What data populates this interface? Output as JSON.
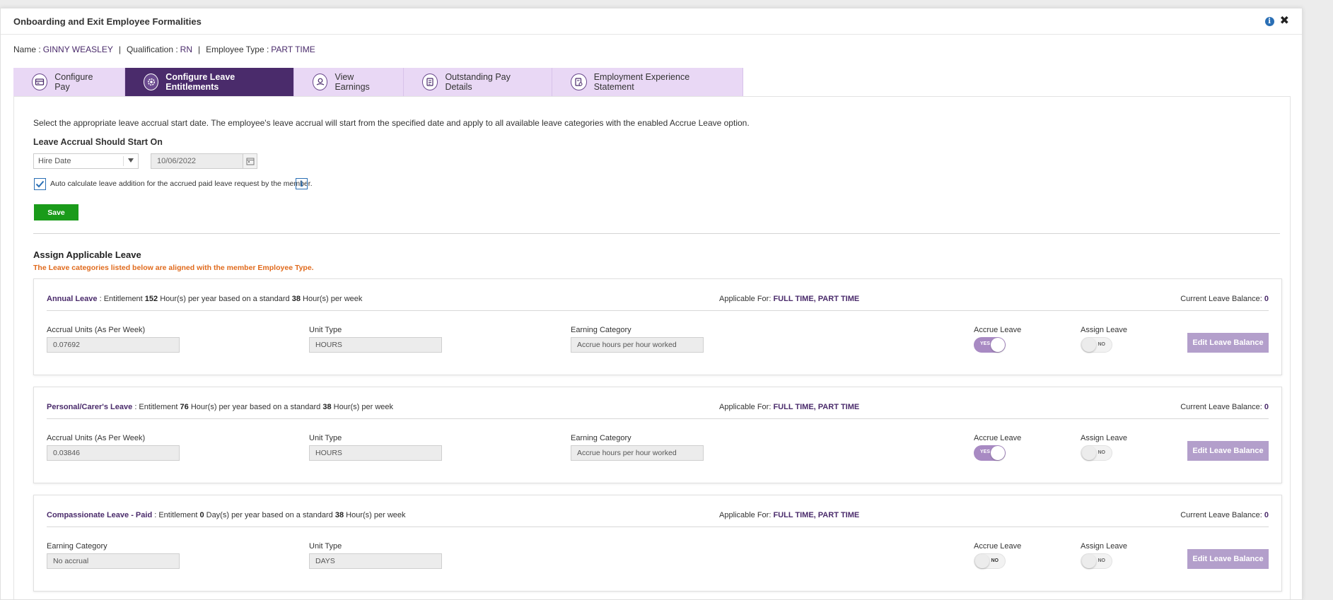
{
  "modal": {
    "title": "Onboarding and Exit Employee Formalities",
    "icons": [
      "info-icon",
      "close-icon"
    ]
  },
  "employee": {
    "name_label": "Name :",
    "name": "GINNY WEASLEY",
    "qual_label": "Qualification :",
    "qualification": "RN",
    "type_label": "Employee Type :",
    "type": "PART TIME",
    "separator": "|"
  },
  "tabs": [
    {
      "label": "Configure Pay",
      "icon": "card-icon",
      "active": false
    },
    {
      "label": "Configure Leave Entitlements",
      "icon": "gear-icon",
      "active": true
    },
    {
      "label": "View Earnings",
      "icon": "earnings-icon",
      "active": false
    },
    {
      "label": "Outstanding Pay Details",
      "icon": "document-icon",
      "active": false
    },
    {
      "label": "Employment Experience Statement",
      "icon": "statement-icon",
      "active": false
    }
  ],
  "accrual": {
    "intro": "Select the appropriate leave accrual start date. The employee's leave accrual will start from the specified date and apply to all available leave categories with the enabled Accrue Leave option.",
    "label": "Leave Accrual Should Start On",
    "select_value": "Hire Date",
    "date_value": "10/06/2022",
    "auto_calc_label": "Auto calculate leave addition for the accrued paid leave request by the member.",
    "auto_calc_checked": true,
    "save_label": "Save"
  },
  "assign": {
    "title": "Assign Applicable Leave",
    "note": "The Leave categories listed below are aligned with the member Employee Type."
  },
  "common": {
    "applicable_label": "Applicable For:",
    "balance_label": "Current Leave Balance:",
    "accrue_label": "Accrue Leave",
    "assign_label": "Assign Leave",
    "edit_label": "Edit Leave Balance",
    "yes": "YES",
    "no": "NO"
  },
  "leaves": [
    {
      "name": "Annual Leave",
      "ent_pre": ": Entitlement",
      "ent_value": "152",
      "ent_mid": "Hour(s) per year based on a standard",
      "std_value": "38",
      "ent_post": "Hour(s) per week",
      "applicable": "FULL TIME, PART TIME",
      "balance": "0",
      "f1_label": "Accrual Units (As Per Week)",
      "f1_value": "0.07692",
      "f2_label": "Unit Type",
      "f2_value": "HOURS",
      "f3_label": "Earning Category",
      "f3_value": "Accrue hours per hour worked",
      "accrue_on": true,
      "assign_on": false
    },
    {
      "name": "Personal/Carer's Leave",
      "ent_pre": ": Entitlement",
      "ent_value": "76",
      "ent_mid": "Hour(s) per year based on a standard",
      "std_value": "38",
      "ent_post": "Hour(s) per week",
      "applicable": "FULL TIME, PART TIME",
      "balance": "0",
      "f1_label": "Accrual Units (As Per Week)",
      "f1_value": "0.03846",
      "f2_label": "Unit Type",
      "f2_value": "HOURS",
      "f3_label": "Earning Category",
      "f3_value": "Accrue hours per hour worked",
      "accrue_on": true,
      "assign_on": false
    },
    {
      "name": "Compassionate Leave - Paid",
      "ent_pre": ": Entitlement",
      "ent_value": "0",
      "ent_mid": "Day(s) per year based on a standard",
      "std_value": "38",
      "ent_post": "Hour(s) per week",
      "applicable": "FULL TIME, PART TIME",
      "balance": "0",
      "f1_label": "Earning Category",
      "f1_value": "No accrual",
      "f2_label": "Unit Type",
      "f2_value": "DAYS",
      "accrue_on": false,
      "assign_on": false
    }
  ]
}
